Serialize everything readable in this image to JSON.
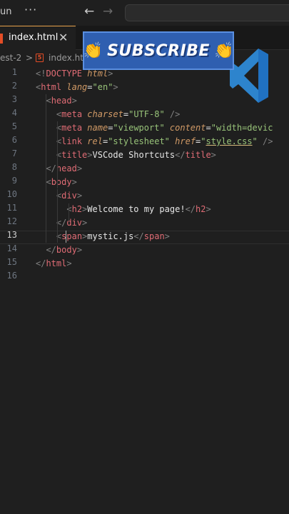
{
  "titlebar": {
    "menu_label": "un",
    "more_label": "···",
    "back_glyph": "←",
    "forward_glyph": "→"
  },
  "tabs": [
    {
      "label": "index.html",
      "close": "✕",
      "active": true
    }
  ],
  "breadcrumb": {
    "folder": "est-2",
    "separator": ">",
    "file_icon": "5",
    "file": "index.html"
  },
  "banner": {
    "text": "SUBSCRIBE",
    "hand_icon": "👏"
  },
  "colors": {
    "accent": "#e8a24a",
    "html_icon": "#e44d26",
    "banner_bg": "#2f5fb0",
    "vscode_blue": "#2f8fe0"
  },
  "editor": {
    "active_line": 13,
    "line_numbers": [
      "1",
      "2",
      "3",
      "4",
      "5",
      "6",
      "7",
      "8",
      "9",
      "10",
      "11",
      "12",
      "13",
      "14",
      "15",
      "16"
    ],
    "lines": [
      [
        {
          "t": "<!",
          "c": "p"
        },
        {
          "t": "DOCTYPE",
          "c": "tag"
        },
        {
          "t": " ",
          "c": "text"
        },
        {
          "t": "html",
          "c": "attr"
        },
        {
          "t": ">",
          "c": "p"
        }
      ],
      [
        {
          "t": "<",
          "c": "p"
        },
        {
          "t": "html",
          "c": "tag"
        },
        {
          "t": " ",
          "c": "text"
        },
        {
          "t": "lang",
          "c": "attr"
        },
        {
          "t": "=",
          "c": "text"
        },
        {
          "t": "\"en\"",
          "c": "str"
        },
        {
          "t": ">",
          "c": "p"
        }
      ],
      [
        {
          "t": "  ",
          "c": "text"
        },
        {
          "t": "<",
          "c": "p"
        },
        {
          "t": "head",
          "c": "tag"
        },
        {
          "t": ">",
          "c": "p"
        }
      ],
      [
        {
          "t": "    ",
          "c": "text"
        },
        {
          "t": "<",
          "c": "p"
        },
        {
          "t": "meta",
          "c": "tag"
        },
        {
          "t": " ",
          "c": "text"
        },
        {
          "t": "charset",
          "c": "attr"
        },
        {
          "t": "=",
          "c": "text"
        },
        {
          "t": "\"UTF-8\"",
          "c": "str"
        },
        {
          "t": " />",
          "c": "p"
        }
      ],
      [
        {
          "t": "    ",
          "c": "text"
        },
        {
          "t": "<",
          "c": "p"
        },
        {
          "t": "meta",
          "c": "tag"
        },
        {
          "t": " ",
          "c": "text"
        },
        {
          "t": "name",
          "c": "attr"
        },
        {
          "t": "=",
          "c": "text"
        },
        {
          "t": "\"viewport\"",
          "c": "str"
        },
        {
          "t": " ",
          "c": "text"
        },
        {
          "t": "content",
          "c": "attr"
        },
        {
          "t": "=",
          "c": "text"
        },
        {
          "t": "\"width=devic",
          "c": "str"
        }
      ],
      [
        {
          "t": "    ",
          "c": "text"
        },
        {
          "t": "<",
          "c": "p"
        },
        {
          "t": "link",
          "c": "tag"
        },
        {
          "t": " ",
          "c": "text"
        },
        {
          "t": "rel",
          "c": "attr"
        },
        {
          "t": "=",
          "c": "text"
        },
        {
          "t": "\"stylesheet\"",
          "c": "str"
        },
        {
          "t": " ",
          "c": "text"
        },
        {
          "t": "href",
          "c": "attr"
        },
        {
          "t": "=",
          "c": "text"
        },
        {
          "t": "\"",
          "c": "str"
        },
        {
          "t": "style.css",
          "c": "link"
        },
        {
          "t": "\"",
          "c": "str"
        },
        {
          "t": " />",
          "c": "p"
        }
      ],
      [
        {
          "t": "    ",
          "c": "text"
        },
        {
          "t": "<",
          "c": "p"
        },
        {
          "t": "title",
          "c": "tag"
        },
        {
          "t": ">",
          "c": "p"
        },
        {
          "t": "VSCode Shortcuts",
          "c": "text"
        },
        {
          "t": "</",
          "c": "p"
        },
        {
          "t": "title",
          "c": "tag"
        },
        {
          "t": ">",
          "c": "p"
        }
      ],
      [
        {
          "t": "  ",
          "c": "text"
        },
        {
          "t": "</",
          "c": "p"
        },
        {
          "t": "head",
          "c": "tag"
        },
        {
          "t": ">",
          "c": "p"
        }
      ],
      [
        {
          "t": "  ",
          "c": "text"
        },
        {
          "t": "<",
          "c": "p"
        },
        {
          "t": "body",
          "c": "tag"
        },
        {
          "t": ">",
          "c": "p"
        }
      ],
      [
        {
          "t": "    ",
          "c": "text"
        },
        {
          "t": "<",
          "c": "p"
        },
        {
          "t": "div",
          "c": "tag"
        },
        {
          "t": ">",
          "c": "p"
        }
      ],
      [
        {
          "t": "      ",
          "c": "text"
        },
        {
          "t": "<",
          "c": "p"
        },
        {
          "t": "h2",
          "c": "tag"
        },
        {
          "t": ">",
          "c": "p"
        },
        {
          "t": "Welcome to my page!",
          "c": "text"
        },
        {
          "t": "</",
          "c": "p"
        },
        {
          "t": "h2",
          "c": "tag"
        },
        {
          "t": ">",
          "c": "p"
        }
      ],
      [
        {
          "t": "    ",
          "c": "text"
        },
        {
          "t": "</",
          "c": "p"
        },
        {
          "t": "div",
          "c": "tag"
        },
        {
          "t": ">",
          "c": "p"
        }
      ],
      [
        {
          "t": "    ",
          "c": "text"
        },
        {
          "t": "<",
          "c": "p"
        },
        {
          "t": "span",
          "c": "tag"
        },
        {
          "t": ">",
          "c": "p"
        },
        {
          "t": "mystic.js",
          "c": "text"
        },
        {
          "t": "</",
          "c": "p"
        },
        {
          "t": "span",
          "c": "tag"
        },
        {
          "t": ">",
          "c": "p"
        }
      ],
      [
        {
          "t": "  ",
          "c": "text"
        },
        {
          "t": "</",
          "c": "p"
        },
        {
          "t": "body",
          "c": "tag"
        },
        {
          "t": ">",
          "c": "p"
        }
      ],
      [
        {
          "t": "</",
          "c": "p"
        },
        {
          "t": "html",
          "c": "tag"
        },
        {
          "t": ">",
          "c": "p"
        }
      ],
      []
    ]
  }
}
